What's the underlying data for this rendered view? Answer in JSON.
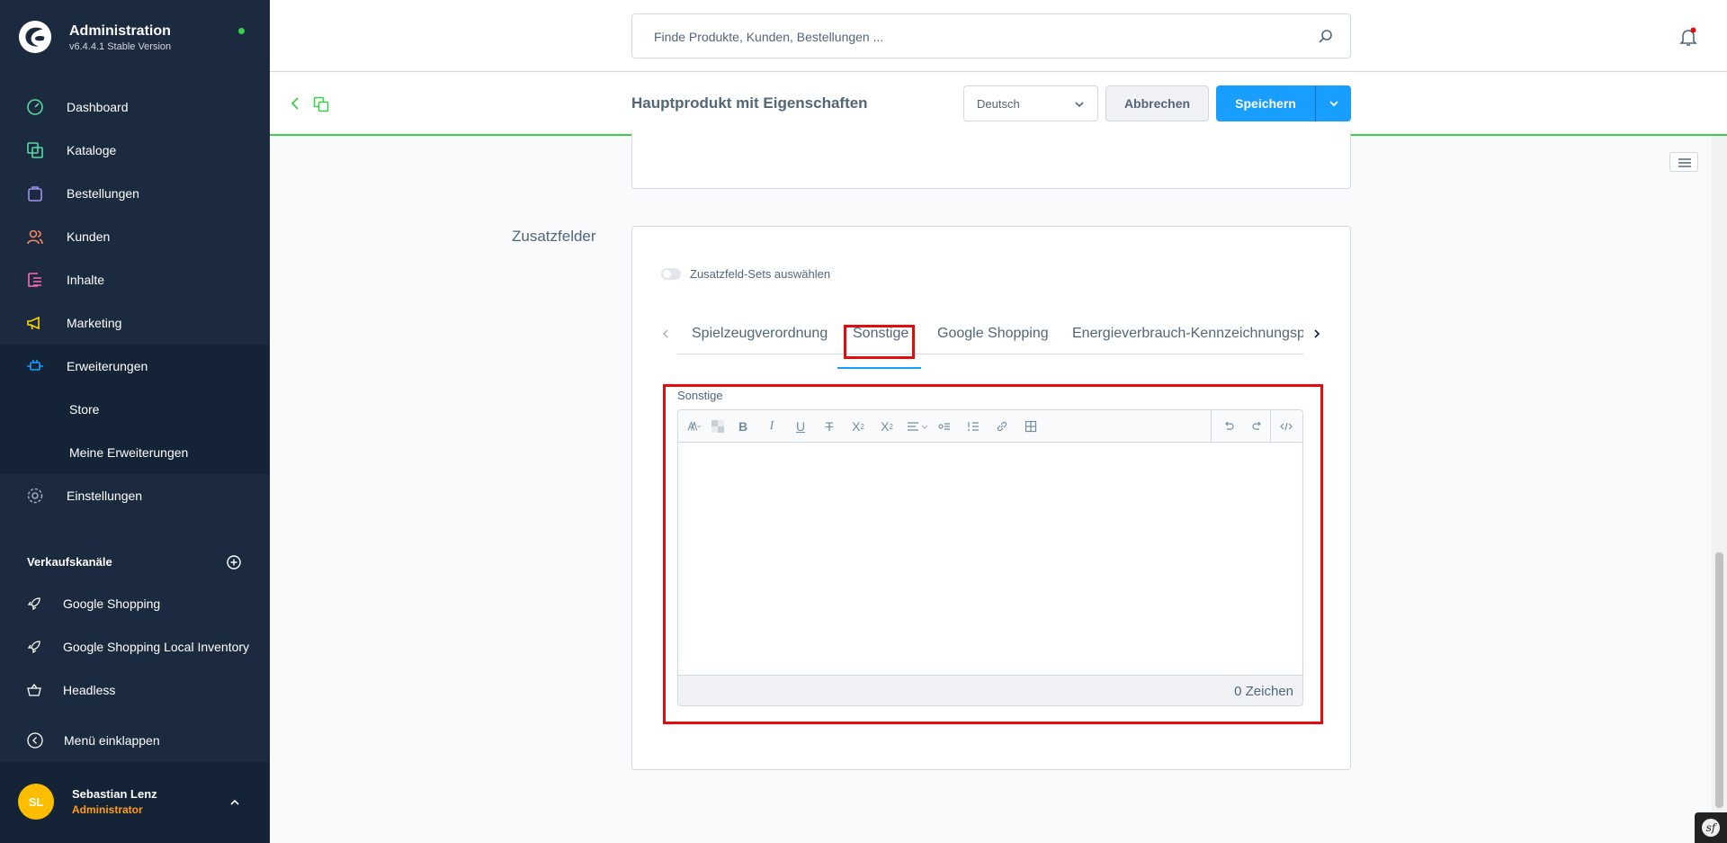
{
  "brand": {
    "title": "Administration",
    "version": "v6.4.4.1 Stable Version"
  },
  "nav": [
    {
      "label": "Dashboard",
      "icon": "dashboard-icon"
    },
    {
      "label": "Kataloge",
      "icon": "catalog-icon"
    },
    {
      "label": "Bestellungen",
      "icon": "orders-icon"
    },
    {
      "label": "Kunden",
      "icon": "customers-icon"
    },
    {
      "label": "Inhalte",
      "icon": "content-icon"
    },
    {
      "label": "Marketing",
      "icon": "marketing-icon"
    },
    {
      "label": "Erweiterungen",
      "icon": "extensions-icon"
    }
  ],
  "subnav": [
    {
      "label": "Store"
    },
    {
      "label": "Meine Erweiterungen"
    }
  ],
  "settings": {
    "label": "Einstellungen"
  },
  "channels": {
    "title": "Verkaufskanäle",
    "items": [
      {
        "label": "Google Shopping"
      },
      {
        "label": "Google Shopping Local Inventory"
      },
      {
        "label": "Headless"
      }
    ]
  },
  "collapse": {
    "label": "Menü einklappen"
  },
  "user": {
    "initials": "SL",
    "name": "Sebastian Lenz",
    "role": "Administrator"
  },
  "search": {
    "placeholder": "Finde Produkte, Kunden, Bestellungen ..."
  },
  "smartbar": {
    "title": "Hauptprodukt mit Eigenschaften",
    "language": "Deutsch",
    "cancel": "Abbrechen",
    "save": "Speichern"
  },
  "custom_fields": {
    "section_label": "Zusatzfelder",
    "toggle_label": "Zusatzfeld-Sets auswählen",
    "tabs": [
      {
        "label": "Spielzeugverordnung"
      },
      {
        "label": "Sonstige"
      },
      {
        "label": "Google Shopping"
      },
      {
        "label": "Energieverbrauch-Kennzeichnungspflicht"
      }
    ],
    "active_tab": "Sonstige",
    "editor_label": "Sonstige",
    "char_count": "0 Zeichen"
  },
  "colors": {
    "sidebar_bg": "#1b2a3e",
    "accent": "#189eff",
    "highlight": "#e10d0d",
    "brand_green": "#37d046"
  }
}
